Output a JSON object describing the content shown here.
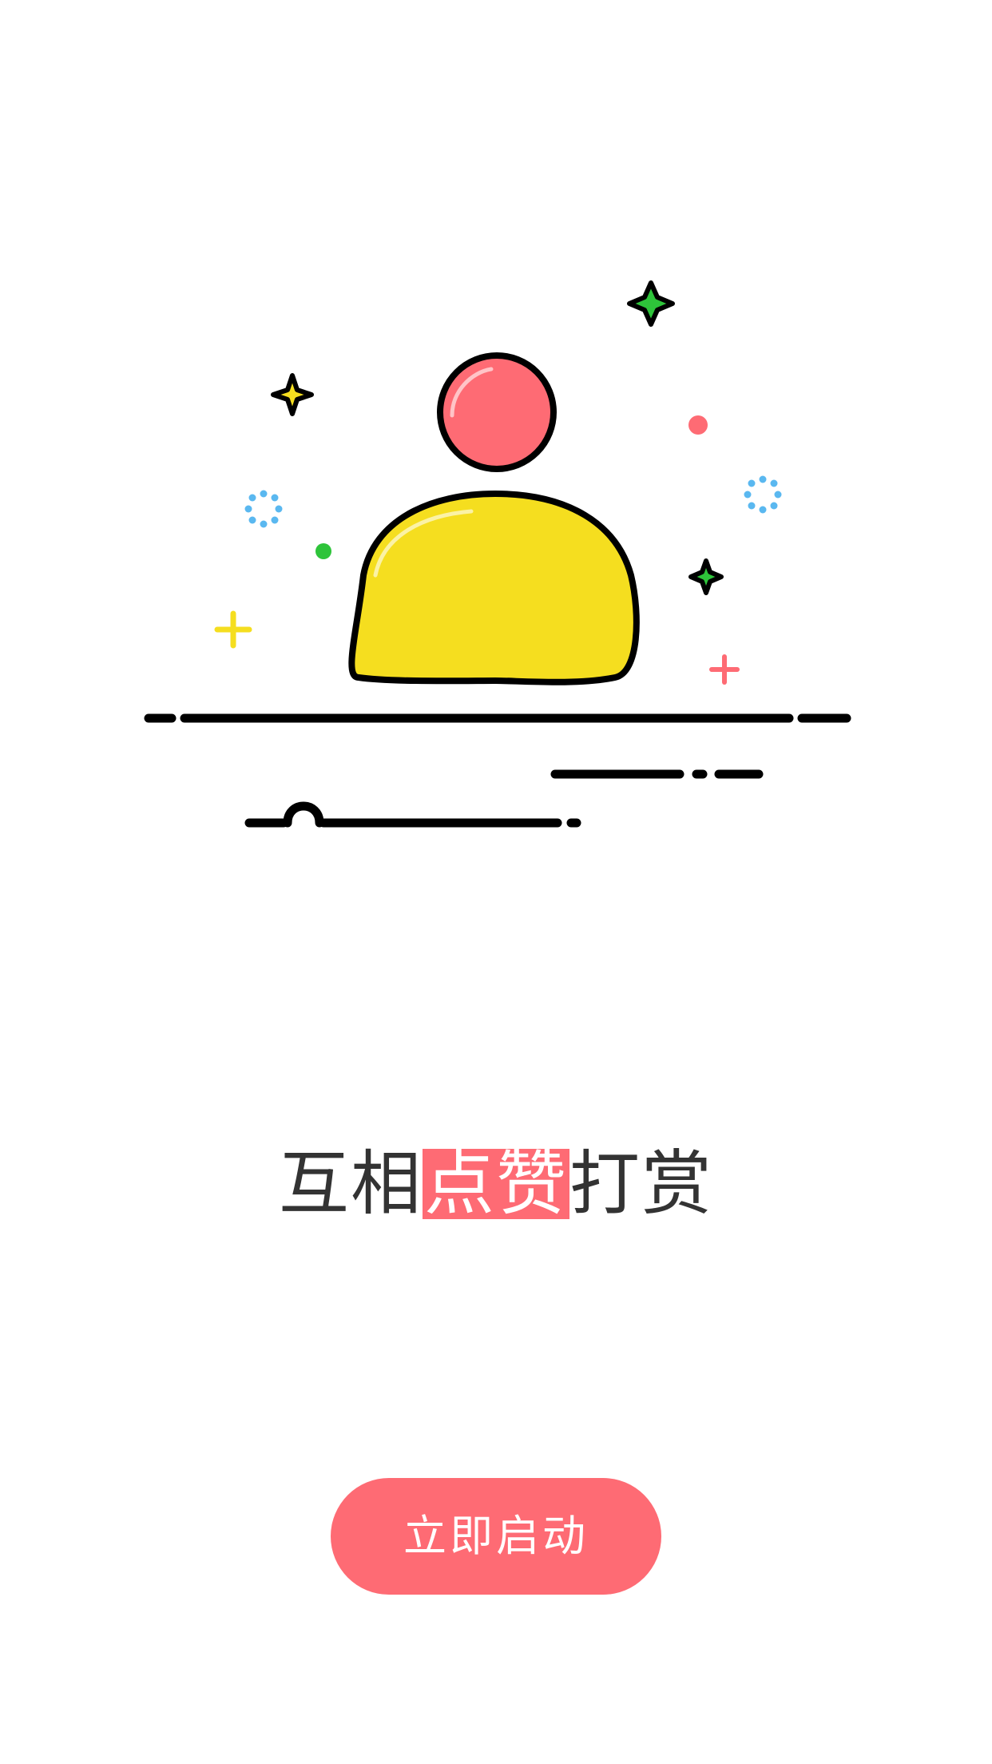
{
  "slogan": {
    "part1": "互相",
    "highlight": "点赞",
    "part2": "打赏"
  },
  "start_button": {
    "label": "立即启动"
  },
  "colors": {
    "accent": "#fe6b74",
    "text": "#333333",
    "yellow": "#f5de1f",
    "green": "#2ec43a",
    "blue": "#5ab8f0",
    "outline": "#000000"
  },
  "icons": {
    "illustration": "user-silhouette-icon"
  }
}
